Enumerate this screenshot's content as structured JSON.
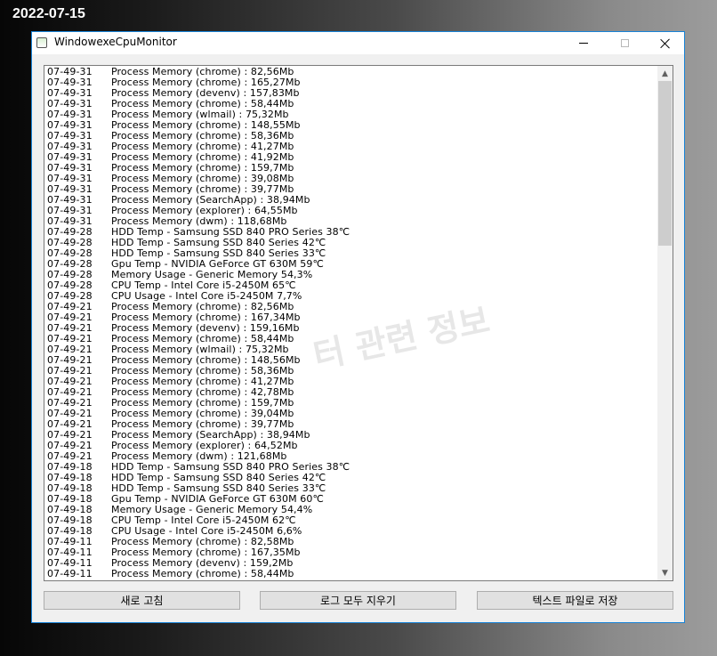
{
  "date_label": "2022-07-15",
  "window": {
    "title": "WindowexeCpuMonitor"
  },
  "watermark": "터 관련 정보",
  "log": [
    {
      "time": "07-49-31",
      "msg": "Process Memory (chrome) : 82,56Mb"
    },
    {
      "time": "07-49-31",
      "msg": "Process Memory (chrome) : 165,27Mb"
    },
    {
      "time": "07-49-31",
      "msg": "Process Memory (devenv) : 157,83Mb"
    },
    {
      "time": "07-49-31",
      "msg": "Process Memory (chrome) : 58,44Mb"
    },
    {
      "time": "07-49-31",
      "msg": "Process Memory (wlmail) : 75,32Mb"
    },
    {
      "time": "07-49-31",
      "msg": "Process Memory (chrome) : 148,55Mb"
    },
    {
      "time": "07-49-31",
      "msg": "Process Memory (chrome) : 58,36Mb"
    },
    {
      "time": "07-49-31",
      "msg": "Process Memory (chrome) : 41,27Mb"
    },
    {
      "time": "07-49-31",
      "msg": "Process Memory (chrome) : 41,92Mb"
    },
    {
      "time": "07-49-31",
      "msg": "Process Memory (chrome) : 159,7Mb"
    },
    {
      "time": "07-49-31",
      "msg": "Process Memory (chrome) : 39,08Mb"
    },
    {
      "time": "07-49-31",
      "msg": "Process Memory (chrome) : 39,77Mb"
    },
    {
      "time": "07-49-31",
      "msg": "Process Memory (SearchApp) : 38,94Mb"
    },
    {
      "time": "07-49-31",
      "msg": "Process Memory (explorer) : 64,55Mb"
    },
    {
      "time": "07-49-31",
      "msg": "Process Memory (dwm) : 118,68Mb"
    },
    {
      "time": "07-49-28",
      "msg": "HDD Temp  - Samsung SSD 840 PRO Series 38℃"
    },
    {
      "time": "07-49-28",
      "msg": "HDD Temp  - Samsung SSD 840 Series 42℃"
    },
    {
      "time": "07-49-28",
      "msg": "HDD Temp  - Samsung SSD 840 Series 33℃"
    },
    {
      "time": "07-49-28",
      "msg": "Gpu Temp  - NVIDIA GeForce GT 630M 59℃"
    },
    {
      "time": "07-49-28",
      "msg": "Memory Usage  - Generic Memory 54,3%"
    },
    {
      "time": "07-49-28",
      "msg": "CPU Temp  - Intel Core i5-2450M 65℃"
    },
    {
      "time": "07-49-28",
      "msg": "CPU Usage  - Intel Core i5-2450M 7,7%"
    },
    {
      "time": "07-49-21",
      "msg": "Process Memory (chrome) : 82,56Mb"
    },
    {
      "time": "07-49-21",
      "msg": "Process Memory (chrome) : 167,34Mb"
    },
    {
      "time": "07-49-21",
      "msg": "Process Memory (devenv) : 159,16Mb"
    },
    {
      "time": "07-49-21",
      "msg": "Process Memory (chrome) : 58,44Mb"
    },
    {
      "time": "07-49-21",
      "msg": "Process Memory (wlmail) : 75,32Mb"
    },
    {
      "time": "07-49-21",
      "msg": "Process Memory (chrome) : 148,56Mb"
    },
    {
      "time": "07-49-21",
      "msg": "Process Memory (chrome) : 58,36Mb"
    },
    {
      "time": "07-49-21",
      "msg": "Process Memory (chrome) : 41,27Mb"
    },
    {
      "time": "07-49-21",
      "msg": "Process Memory (chrome) : 42,78Mb"
    },
    {
      "time": "07-49-21",
      "msg": "Process Memory (chrome) : 159,7Mb"
    },
    {
      "time": "07-49-21",
      "msg": "Process Memory (chrome) : 39,04Mb"
    },
    {
      "time": "07-49-21",
      "msg": "Process Memory (chrome) : 39,77Mb"
    },
    {
      "time": "07-49-21",
      "msg": "Process Memory (SearchApp) : 38,94Mb"
    },
    {
      "time": "07-49-21",
      "msg": "Process Memory (explorer) : 64,52Mb"
    },
    {
      "time": "07-49-21",
      "msg": "Process Memory (dwm) : 121,68Mb"
    },
    {
      "time": "07-49-18",
      "msg": "HDD Temp  - Samsung SSD 840 PRO Series 38℃"
    },
    {
      "time": "07-49-18",
      "msg": "HDD Temp  - Samsung SSD 840 Series 42℃"
    },
    {
      "time": "07-49-18",
      "msg": "HDD Temp  - Samsung SSD 840 Series 33℃"
    },
    {
      "time": "07-49-18",
      "msg": "Gpu Temp  - NVIDIA GeForce GT 630M 60℃"
    },
    {
      "time": "07-49-18",
      "msg": "Memory Usage  - Generic Memory 54,4%"
    },
    {
      "time": "07-49-18",
      "msg": "CPU Temp  - Intel Core i5-2450M 62℃"
    },
    {
      "time": "07-49-18",
      "msg": "CPU Usage  - Intel Core i5-2450M 6,6%"
    },
    {
      "time": "07-49-11",
      "msg": "Process Memory (chrome) : 82,58Mb"
    },
    {
      "time": "07-49-11",
      "msg": "Process Memory (chrome) : 167,35Mb"
    },
    {
      "time": "07-49-11",
      "msg": "Process Memory (devenv) : 159,2Mb"
    },
    {
      "time": "07-49-11",
      "msg": "Process Memory (chrome) : 58,44Mb"
    }
  ],
  "buttons": {
    "refresh": "새로 고침",
    "clear": "로그 모두 지우기",
    "save": "텍스트 파일로 저장"
  },
  "icons": {
    "app": "app-icon",
    "minimize": "minimize-icon",
    "maximize": "maximize-icon",
    "close": "close-icon",
    "scroll_up": "scroll-up-arrow-icon",
    "scroll_down": "scroll-down-arrow-icon"
  },
  "colors": {
    "window_border": "#1883d7"
  }
}
